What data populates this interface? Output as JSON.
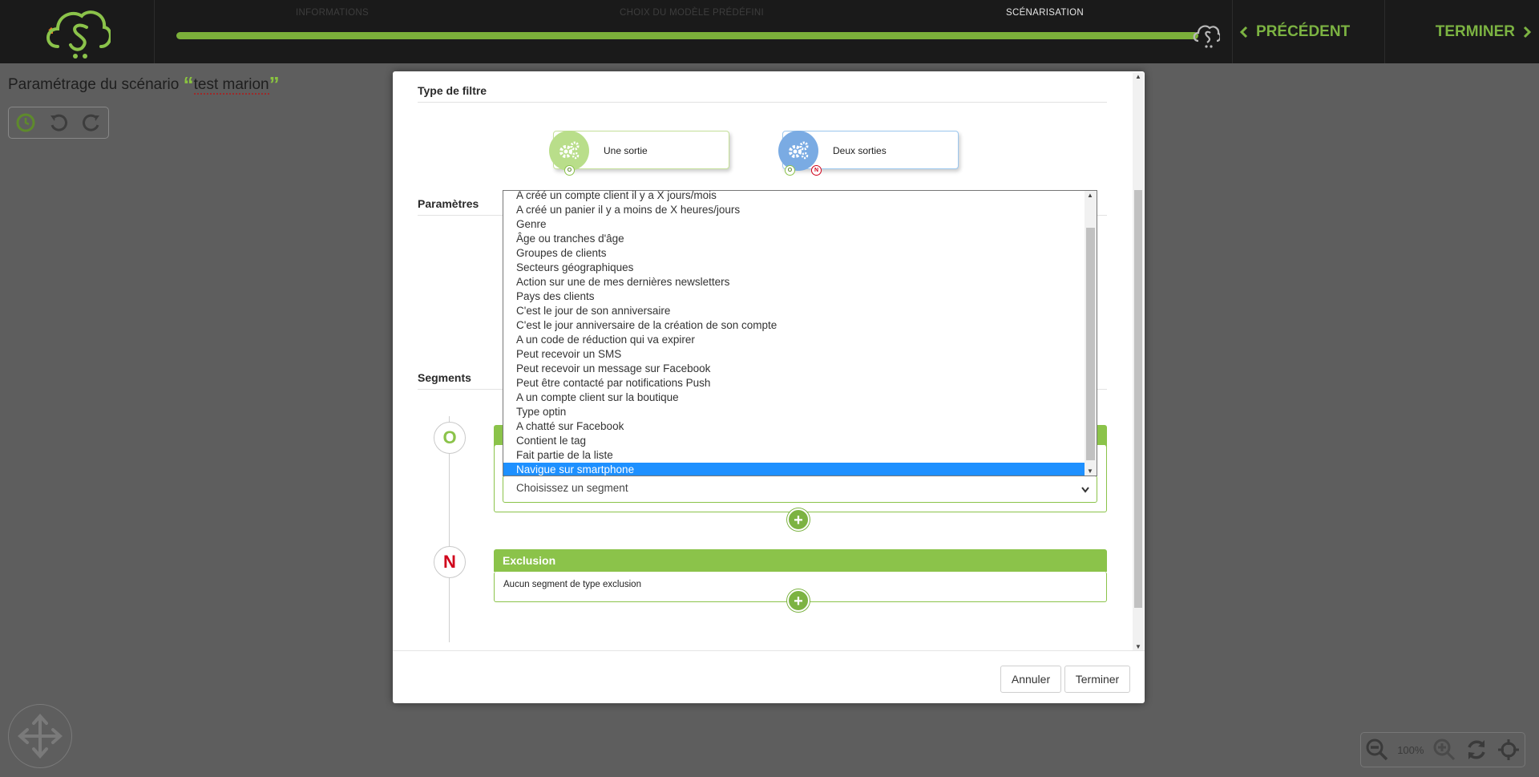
{
  "steps": [
    "INFORMATIONS",
    "CHOIX DU MODÈLE PRÉDÉFINI",
    "SCÉNARISATION"
  ],
  "nav": {
    "prev_label": "PRÉCÉDENT",
    "finish_label": "TERMINER"
  },
  "page": {
    "title_prefix": "Paramétrage du scénario",
    "scenario_name": "test marion"
  },
  "zoom": {
    "level": "100%"
  },
  "modal": {
    "filter_type_label": "Type de filtre",
    "filter_one_output": "Une sortie",
    "filter_two_outputs": "Deux sorties",
    "port_o": "O",
    "port_n": "N",
    "parameters_label": "Paramètres",
    "segments_label": "Segments",
    "segment_o_letter": "O",
    "segment_n_letter": "N",
    "exclusion_title": "Exclusion",
    "exclusion_empty": "Aucun segment de type exclusion",
    "select_placeholder": "Choisissez un segment",
    "dropdown_options": [
      "A créé un compte client il y a X jours/mois",
      "A créé un panier il y a moins de X heures/jours",
      "Genre",
      "Âge ou tranches d'âge",
      "Groupes de clients",
      "Secteurs géographiques",
      "Action sur une de mes dernières newsletters",
      "Pays des clients",
      "C'est le jour de son anniversaire",
      "C'est le jour anniversaire de la création de son compte",
      "A un code de réduction qui va expirer",
      "Peut recevoir un SMS",
      "Peut recevoir un message sur Facebook",
      "Peut être contacté par notifications Push",
      "A un compte client sur la boutique",
      "Type optin",
      "A chatté sur Facebook",
      "Contient le tag",
      "Fait partie de la liste",
      "Navigue sur smartphone"
    ],
    "selected_option": "Navigue sur smartphone",
    "cancel_label": "Annuler",
    "finish_label": "Terminer"
  },
  "colors": {
    "brand_green": "#8bc34a",
    "accent_blue": "#1e90ff",
    "exclusion_red": "#d0021b"
  }
}
